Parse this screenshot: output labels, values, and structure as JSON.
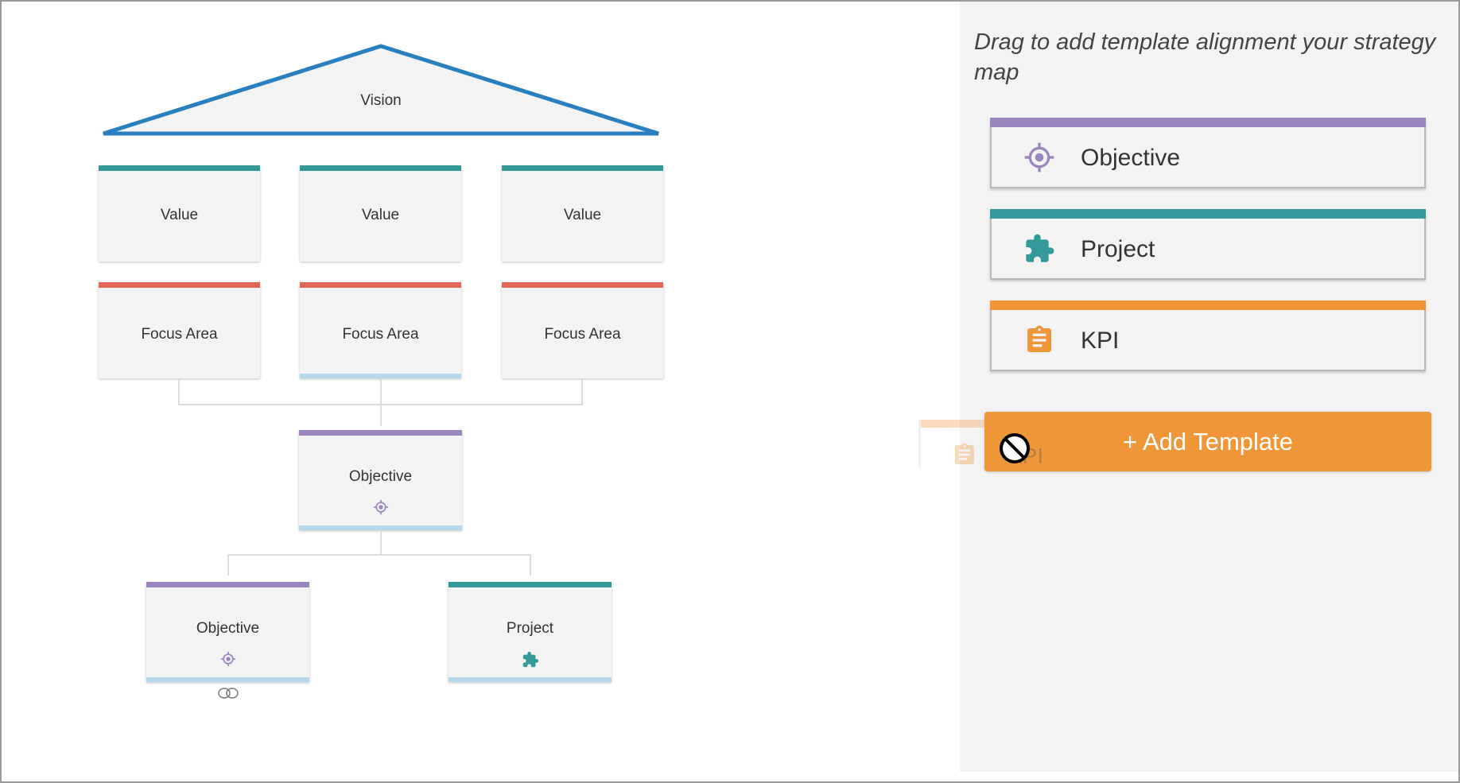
{
  "canvas": {
    "vision": {
      "label": "Vision"
    },
    "values": [
      {
        "label": "Value"
      },
      {
        "label": "Value"
      },
      {
        "label": "Value"
      }
    ],
    "focus_areas": [
      {
        "label": "Focus Area"
      },
      {
        "label": "Focus Area"
      },
      {
        "label": "Focus Area"
      }
    ],
    "objective_main": {
      "label": "Objective",
      "icon": "target-icon"
    },
    "objective_child": {
      "label": "Objective",
      "icon": "target-icon",
      "badge_icon": "link-icon"
    },
    "project_child": {
      "label": "Project",
      "icon": "puzzle-icon"
    }
  },
  "panel": {
    "title": "Drag to add template alignment your strategy map",
    "templates": [
      {
        "label": "Objective",
        "icon": "target-icon",
        "color": "#9b86bd"
      },
      {
        "label": "Project",
        "icon": "puzzle-icon",
        "color": "#339999"
      },
      {
        "label": "KPI",
        "icon": "clipboard-icon",
        "color": "#ef9639"
      }
    ],
    "add_template_label": "+ Add Template"
  },
  "drag_ghost": {
    "label": "KPI",
    "icon": "clipboard-icon"
  },
  "colors": {
    "vision_stroke": "#2a7fc1",
    "value_bar": "#339999",
    "focus_bar": "#e06655",
    "objective_bar": "#9b86bd",
    "project_bar": "#339999",
    "kpi_bar": "#ef9639",
    "selection_bar": "#b6d8ec"
  }
}
